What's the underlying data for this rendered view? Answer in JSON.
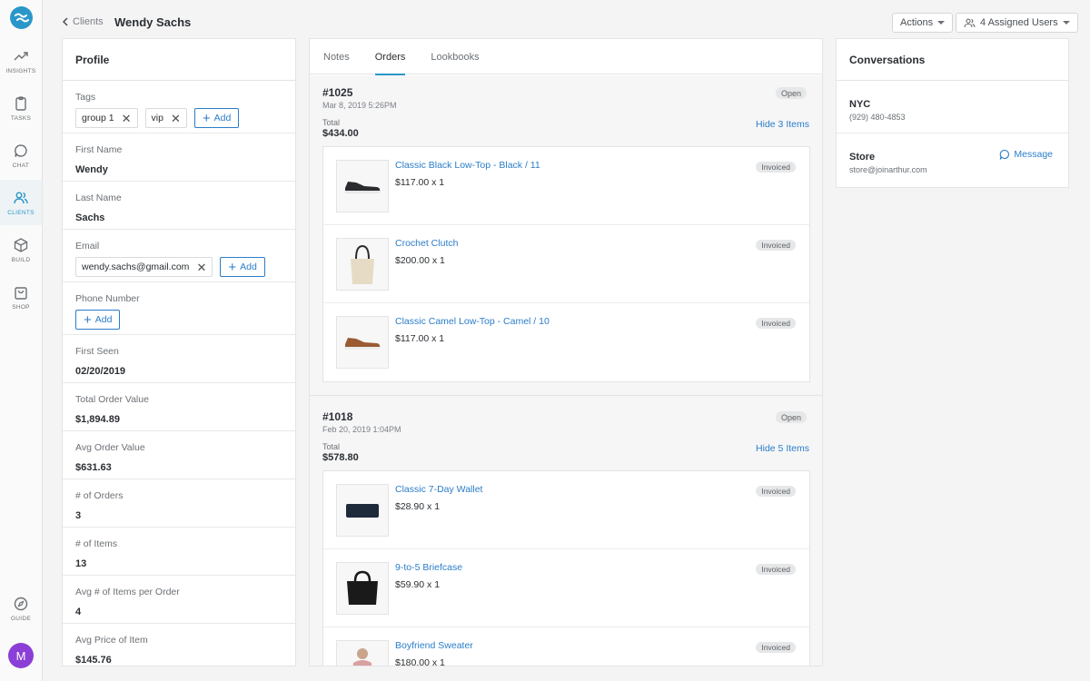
{
  "nav": {
    "items": [
      {
        "label": "INSIGHTS"
      },
      {
        "label": "TASKS"
      },
      {
        "label": "CHAT"
      },
      {
        "label": "CLIENTS"
      },
      {
        "label": "BUILD"
      },
      {
        "label": "SHOP"
      }
    ],
    "guide_label": "GUIDE",
    "avatar_initial": "M",
    "accent_color": "#2b97c9",
    "avatar_color": "#8b3fd6"
  },
  "header": {
    "back_label": "Clients",
    "title": "Wendy Sachs",
    "actions_label": "Actions",
    "assigned_label": "4 Assigned Users"
  },
  "profile": {
    "title": "Profile",
    "tags_label": "Tags",
    "tags": [
      "group 1",
      "vip"
    ],
    "add_label": "Add",
    "first_name_label": "First Name",
    "first_name": "Wendy",
    "last_name_label": "Last Name",
    "last_name": "Sachs",
    "email_label": "Email",
    "email": "wendy.sachs@gmail.com",
    "phone_label": "Phone Number",
    "first_seen_label": "First Seen",
    "first_seen": "02/20/2019",
    "tov_label": "Total Order Value",
    "tov": "$1,894.89",
    "aov_label": "Avg Order Value",
    "aov": "$631.63",
    "orders_label": "# of Orders",
    "orders": "3",
    "items_label": "# of Items",
    "items": "13",
    "ipo_label": "Avg # of Items per Order",
    "ipo": "4",
    "api_label": "Avg Price of Item",
    "api": "$145.76"
  },
  "tabs": [
    {
      "label": "Notes"
    },
    {
      "label": "Orders"
    },
    {
      "label": "Lookbooks"
    }
  ],
  "orders": [
    {
      "number": "#1025",
      "date": "Mar 8, 2019 5:26PM",
      "status": "Open",
      "total_label": "Total",
      "total": "$434.00",
      "hide_label": "Hide 3 Items",
      "items": [
        {
          "name": "Classic Black Low-Top - Black / 11",
          "price": "$117.00 x 1",
          "status": "Invoiced",
          "thumb_icon": "black-sneaker-icon"
        },
        {
          "name": "Crochet Clutch",
          "price": "$200.00 x 1",
          "status": "Invoiced",
          "thumb_icon": "clutch-bag-icon"
        },
        {
          "name": "Classic Camel Low-Top - Camel / 10",
          "price": "$117.00 x 1",
          "status": "Invoiced",
          "thumb_icon": "camel-sneaker-icon"
        }
      ]
    },
    {
      "number": "#1018",
      "date": "Feb 20, 2019 1:04PM",
      "status": "Open",
      "total_label": "Total",
      "total": "$578.80",
      "hide_label": "Hide 5 Items",
      "items": [
        {
          "name": "Classic 7-Day Wallet",
          "price": "$28.90 x 1",
          "status": "Invoiced",
          "thumb_icon": "wallet-icon"
        },
        {
          "name": "9-to-5 Briefcase",
          "price": "$59.90 x 1",
          "status": "Invoiced",
          "thumb_icon": "briefcase-icon"
        },
        {
          "name": "Boyfriend Sweater",
          "price": "$180.00 x 1",
          "status": "Invoiced",
          "thumb_icon": "sweater-icon"
        }
      ]
    }
  ],
  "conversations": {
    "title": "Conversations",
    "items": [
      {
        "name": "NYC",
        "sub": "(929) 480-4853"
      },
      {
        "name": "Store",
        "sub": "store@joinarthur.com",
        "action": "Message"
      }
    ]
  }
}
